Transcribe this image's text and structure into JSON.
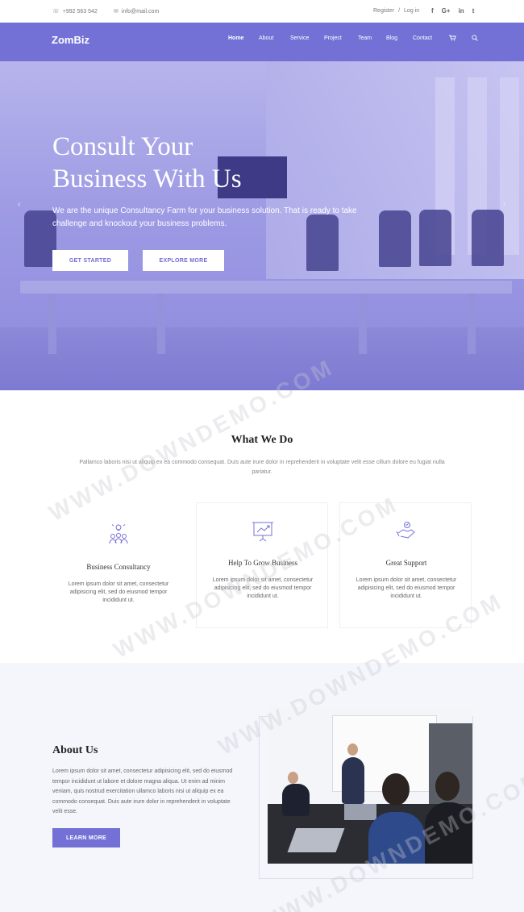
{
  "topbar": {
    "phone": "+992 563 542",
    "email": "info@mail.com",
    "register": "Register",
    "separator": "/",
    "login": "Log in",
    "social": [
      "f",
      "G+",
      "in",
      "t"
    ]
  },
  "nav": {
    "logo": "ZomBiz",
    "items": [
      "Home",
      "About",
      "Service",
      "Project",
      "Team",
      "Blog",
      "Contact"
    ],
    "active": "Home",
    "cart_icon": "cart-icon",
    "search_icon": "search-icon"
  },
  "hero": {
    "title_line1": "Consult Your",
    "title_line2": "Business With Us",
    "text": "We are the unique Consultancy Farm for your business solution. That is ready to take challenge and knockout your business problems.",
    "primary_button": "GET STARTED",
    "secondary_button": "EXPLORE MORE",
    "prev_arrow": "‹",
    "next_arrow": "›"
  },
  "what_we_do": {
    "title": "What We Do",
    "lead": "Pallamco laboris nisi ut aliquip ex ea commodo consequat. Duis aute irure dolor in reprehenderit in voluptate velit esse cillum dolore eu fugiat nulla pariatur.",
    "cards": [
      {
        "icon": "team-idea-icon",
        "title": "Business Consultancy",
        "text": "Lorem ipsum dolor sit amet, consectetur adipisicing elit, sed do eiusmod tempor incididunt ut."
      },
      {
        "icon": "growth-chart-icon",
        "title": "Help To Grow Business",
        "text": "Lorem ipsum dolor sit amet, consectetur adipisicing elit, sed do eiusmod tempor incididunt ut."
      },
      {
        "icon": "support-hand-icon",
        "title": "Great Support",
        "text": "Lorem ipsum dolor sit amet, consectetur adipisicing elit, sed do eiusmod tempor incididunt ut."
      }
    ]
  },
  "about": {
    "title": "About Us",
    "text": "Lorem ipsum dolor sit amet, consectetur adipisicing elit, sed do eiusmod tempor incididunt ut labore et dolore magna aliqua. Ut enim ad minim veniam, quis nostrud exercitation ullamco laboris nisi ut aliquip ex ea commodo consequat. Duis aute irure dolor in reprehenderit in voluptate velit esse.",
    "button": "LEARN MORE"
  },
  "watermark": "WWW.DOWNDEMO.COM",
  "colors": {
    "accent": "#7471d6",
    "hero_overlay": "#9e9be4",
    "about_bg": "#f5f6fc"
  }
}
